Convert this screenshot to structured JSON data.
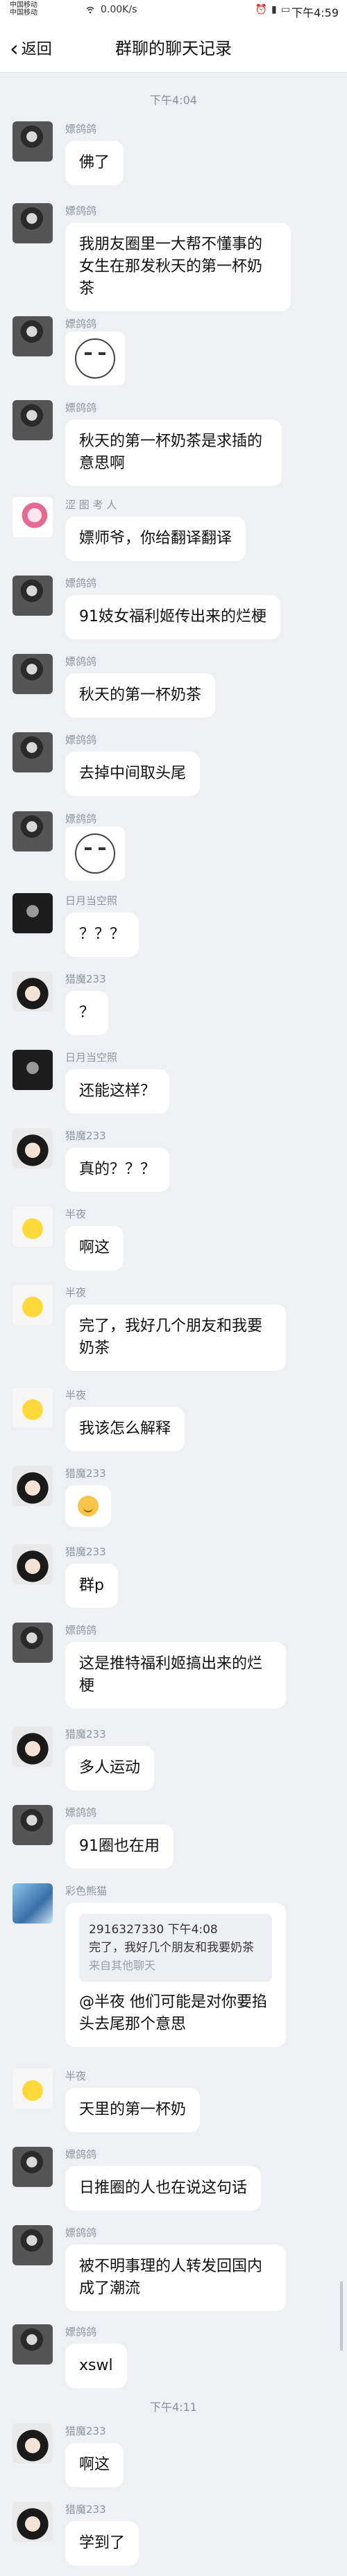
{
  "status_bar": {
    "carrier_line1": "中国移动",
    "carrier_line2": "中国移动",
    "speed": "0.00K/s",
    "time": "下午4:59"
  },
  "nav": {
    "back_label": "返回",
    "title": "群聊的聊天记录"
  },
  "time_dividers": [
    "下午4:04",
    "下午4:11"
  ],
  "messages": [
    {
      "nick": "嫖鸽鸽",
      "text": "佛了"
    },
    {
      "nick": "嫖鸽鸽",
      "text": "我朋友圈里一大帮不懂事的女生在那发秋天的第一杯奶茶"
    },
    {
      "nick": "嫖鸽鸽",
      "text": "",
      "sticker": "sticker-face"
    },
    {
      "nick": "嫖鸽鸽",
      "text": "秋天的第一杯奶茶是求插的意思啊"
    },
    {
      "nick": "涩 图 考 人",
      "text": "嫖师爷，你给翻译翻译"
    },
    {
      "nick": "嫖鸽鸽",
      "text": "91妓女福利姬传出来的烂梗"
    },
    {
      "nick": "嫖鸽鸽",
      "text": "秋天的第一杯奶茶"
    },
    {
      "nick": "嫖鸽鸽",
      "text": "去掉中间取头尾"
    },
    {
      "nick": "嫖鸽鸽",
      "text": "",
      "sticker": "sticker-face"
    },
    {
      "nick": "日月当空照",
      "text": "？？？"
    },
    {
      "nick": "猎魔233",
      "text": "？"
    },
    {
      "nick": "日月当空照",
      "text": "还能这样？"
    },
    {
      "nick": "猎魔233",
      "text": "真的？？？"
    },
    {
      "nick": "半夜",
      "text": "啊这"
    },
    {
      "nick": "半夜",
      "text": "完了，我好几个朋友和我要奶茶"
    },
    {
      "nick": "半夜",
      "text": "我该怎么解释"
    },
    {
      "nick": "猎魔233",
      "text": "",
      "emoji": "smile-emoji"
    },
    {
      "nick": "猎魔233",
      "text": "群p"
    },
    {
      "nick": "嫖鸽鸽",
      "text": "这是推特福利姬搞出来的烂梗"
    },
    {
      "nick": "猎魔233",
      "text": "多人运动"
    },
    {
      "nick": "嫖鸽鸽",
      "text": "91圈也在用"
    },
    {
      "nick": "彩色熊猫",
      "text": "@半夜 他们可能是对你要掐头去尾那个意思",
      "quote": {
        "header": "2916327330 下午4:08",
        "body": "完了，我好几个朋友和我要奶茶",
        "from": "来自其他聊天"
      }
    },
    {
      "nick": "半夜",
      "text": "天里的第一杯奶"
    },
    {
      "nick": "嫖鸽鸽",
      "text": "日推圈的人也在说这句话"
    },
    {
      "nick": "嫖鸽鸽",
      "text": "被不明事理的人转发回国内成了潮流"
    },
    {
      "nick": "嫖鸽鸽",
      "text": "xswl"
    },
    {
      "nick": "猎魔233",
      "text": "啊这"
    },
    {
      "nick": "猎魔233",
      "text": "学到了"
    }
  ]
}
